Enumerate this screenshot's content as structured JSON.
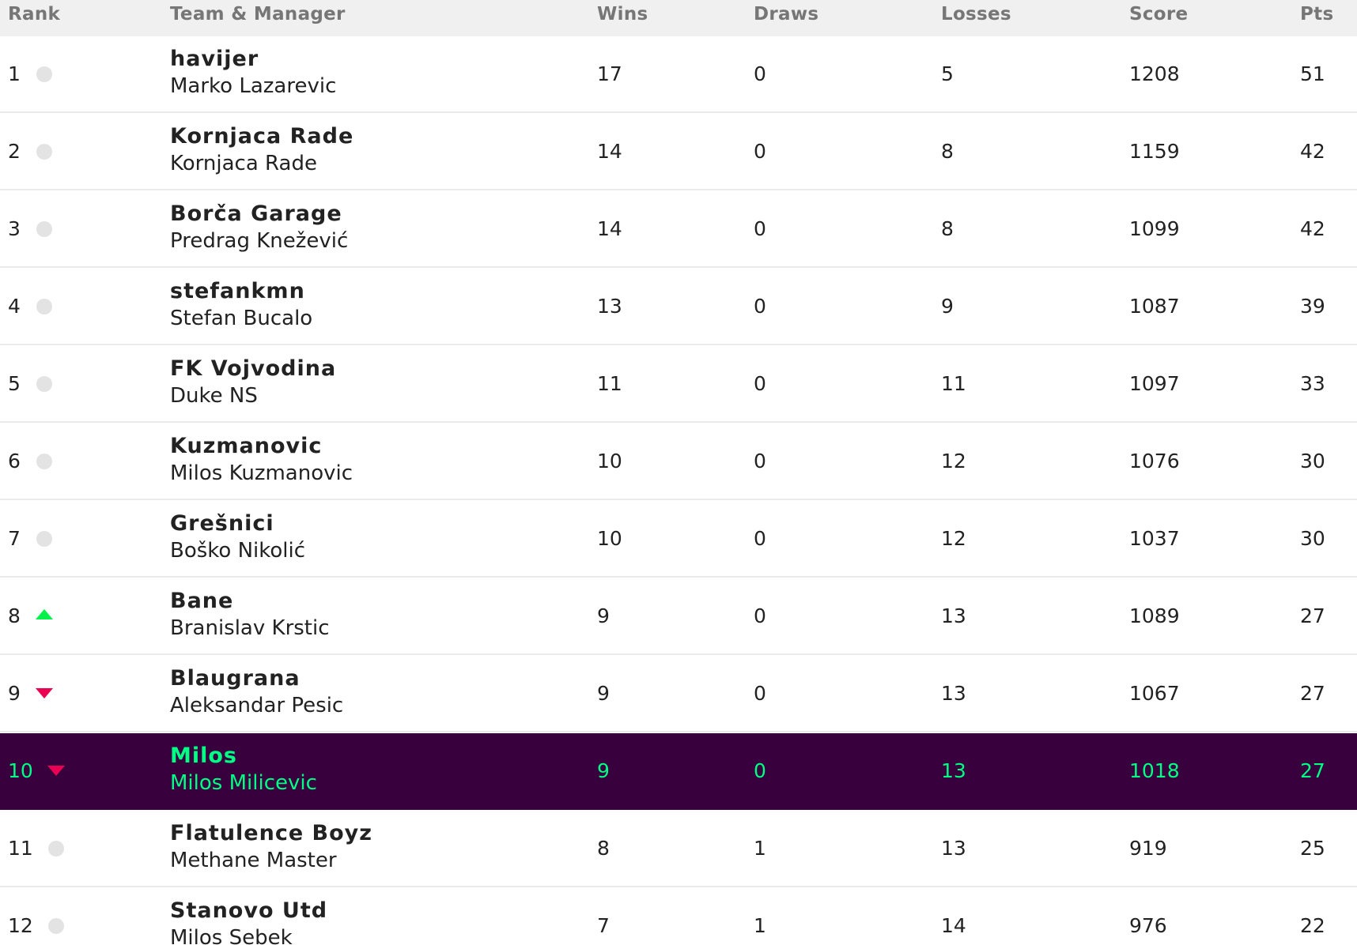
{
  "columns": {
    "rank": "Rank",
    "team_manager": "Team & Manager",
    "wins": "Wins",
    "draws": "Draws",
    "losses": "Losses",
    "score": "Score",
    "pts": "Pts"
  },
  "colors": {
    "header_bg": "#f0f0f0",
    "highlight_bg": "#38003c",
    "highlight_text": "#00ff85",
    "up_arrow": "#05f04b",
    "down_arrow": "#e90052",
    "no_change": "#e3e3e3"
  },
  "rows": [
    {
      "rank": "1",
      "movement": "same",
      "team": "havijer",
      "manager": "Marko Lazarevic",
      "wins": "17",
      "draws": "0",
      "losses": "5",
      "score": "1208",
      "pts": "51",
      "highlight": false
    },
    {
      "rank": "2",
      "movement": "same",
      "team": "Kornjaca Rade",
      "manager": "Kornjaca Rade",
      "wins": "14",
      "draws": "0",
      "losses": "8",
      "score": "1159",
      "pts": "42",
      "highlight": false
    },
    {
      "rank": "3",
      "movement": "same",
      "team": "Borča Garage",
      "manager": "Predrag Knežević",
      "wins": "14",
      "draws": "0",
      "losses": "8",
      "score": "1099",
      "pts": "42",
      "highlight": false
    },
    {
      "rank": "4",
      "movement": "same",
      "team": "stefankmn",
      "manager": "Stefan Bucalo",
      "wins": "13",
      "draws": "0",
      "losses": "9",
      "score": "1087",
      "pts": "39",
      "highlight": false
    },
    {
      "rank": "5",
      "movement": "same",
      "team": "FK Vojvodina",
      "manager": "Duke NS",
      "wins": "11",
      "draws": "0",
      "losses": "11",
      "score": "1097",
      "pts": "33",
      "highlight": false
    },
    {
      "rank": "6",
      "movement": "same",
      "team": "Kuzmanovic",
      "manager": "Milos Kuzmanovic",
      "wins": "10",
      "draws": "0",
      "losses": "12",
      "score": "1076",
      "pts": "30",
      "highlight": false
    },
    {
      "rank": "7",
      "movement": "same",
      "team": "Grešnici",
      "manager": "Boško Nikolić",
      "wins": "10",
      "draws": "0",
      "losses": "12",
      "score": "1037",
      "pts": "30",
      "highlight": false
    },
    {
      "rank": "8",
      "movement": "up",
      "team": "Bane",
      "manager": "Branislav Krstic",
      "wins": "9",
      "draws": "0",
      "losses": "13",
      "score": "1089",
      "pts": "27",
      "highlight": false
    },
    {
      "rank": "9",
      "movement": "down",
      "team": "Blaugrana",
      "manager": "Aleksandar Pesic",
      "wins": "9",
      "draws": "0",
      "losses": "13",
      "score": "1067",
      "pts": "27",
      "highlight": false
    },
    {
      "rank": "10",
      "movement": "down",
      "team": "Milos",
      "manager": "Milos Milicevic",
      "wins": "9",
      "draws": "0",
      "losses": "13",
      "score": "1018",
      "pts": "27",
      "highlight": true
    },
    {
      "rank": "11",
      "movement": "same",
      "team": "Flatulence Boyz",
      "manager": "Methane Master",
      "wins": "8",
      "draws": "1",
      "losses": "13",
      "score": "919",
      "pts": "25",
      "highlight": false
    },
    {
      "rank": "12",
      "movement": "same",
      "team": "Stanovo Utd",
      "manager": "Milos Sebek",
      "wins": "7",
      "draws": "1",
      "losses": "14",
      "score": "976",
      "pts": "22",
      "highlight": false
    }
  ]
}
